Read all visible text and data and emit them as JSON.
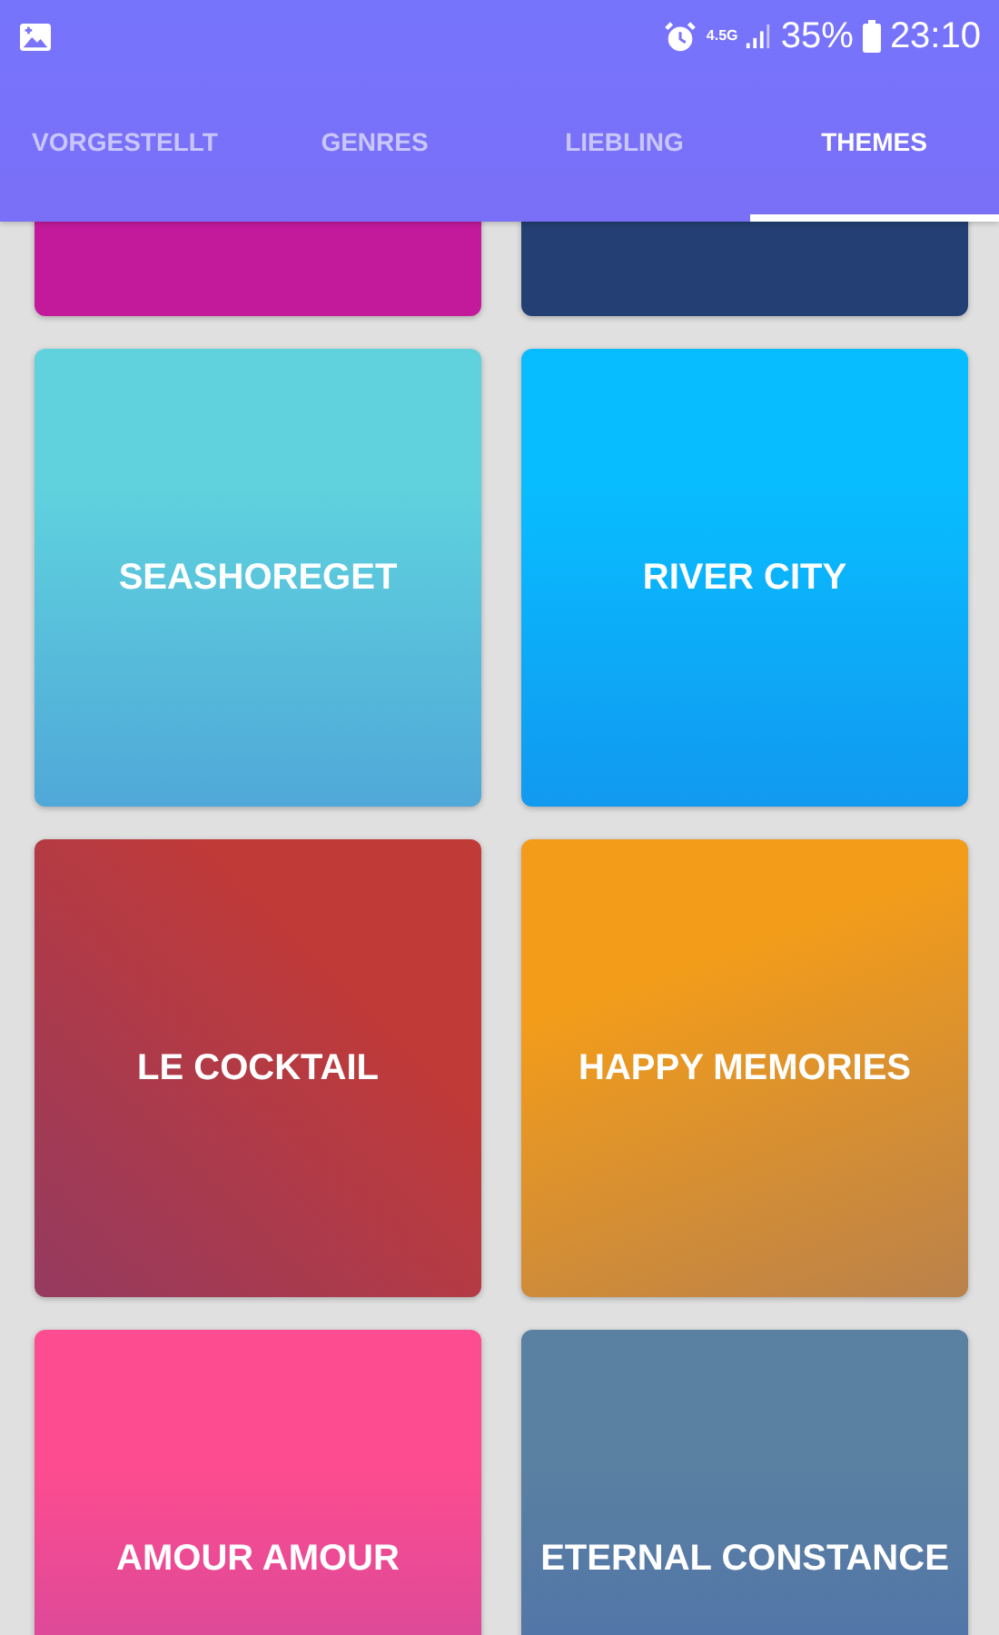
{
  "status_bar": {
    "network": "4.5G",
    "battery": "35%",
    "time": "23:10"
  },
  "tabs": [
    {
      "label": "VORGESTELLT",
      "selected": false
    },
    {
      "label": "GENRES",
      "selected": false
    },
    {
      "label": "LIEBLING",
      "selected": false
    },
    {
      "label": "THEMES",
      "selected": true
    }
  ],
  "themes": [
    {
      "color": "#c31a9c"
    },
    {
      "color": "#233f73"
    },
    {
      "title": "SEASHOREGET",
      "color": "#5fd2de"
    },
    {
      "title": "RIVER CITY",
      "color": "#08bdff"
    },
    {
      "title": "LE COCKTAIL",
      "color": "#c03a38"
    },
    {
      "title": "HAPPY MEMORIES",
      "color": "#f29c1a"
    },
    {
      "title": "AMOUR AMOUR",
      "color": "#fd4c90"
    },
    {
      "title": "ETERNAL CONSTANCE",
      "color": "#5a80a2"
    }
  ]
}
